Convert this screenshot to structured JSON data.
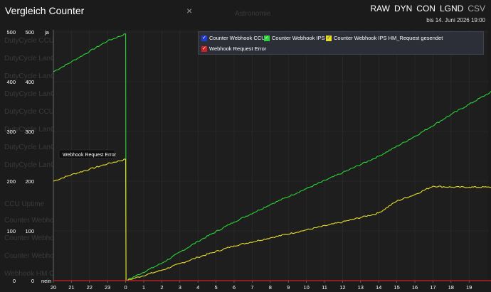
{
  "window": {
    "title": "Vergleich Counter",
    "toolbar": [
      {
        "label": "RAW",
        "active": true
      },
      {
        "label": "DYN",
        "active": true
      },
      {
        "label": "CON",
        "active": true
      },
      {
        "label": "LGND",
        "active": true
      },
      {
        "label": "CSV",
        "active": false
      }
    ],
    "range_label": "bis 14. Juni 2026 19:00"
  },
  "legend": [
    {
      "label": "Counter Webhook CCU",
      "color": "#1f3bd6",
      "checked": true
    },
    {
      "label": "Counter Webhook IPS",
      "color": "#2bd437",
      "checked": true
    },
    {
      "label": "Counter Webhook IPS HM_Request gesendet",
      "color": "#e6df2a",
      "checked": true
    },
    {
      "label": "Webhook Request Error",
      "color": "#d22020",
      "checked": true
    }
  ],
  "tooltip": "Webhook Request Error",
  "chart_data": {
    "type": "line",
    "title": "Vergleich Counter",
    "y_axes": [
      {
        "ticks": [
          "0",
          "100",
          "200",
          "300",
          "400",
          "500"
        ],
        "range": [
          0,
          500
        ]
      },
      {
        "ticks": [
          "0",
          "100",
          "200",
          "300",
          "400",
          "500"
        ],
        "range": [
          0,
          500
        ]
      },
      {
        "ticks": [
          "nein",
          "ja"
        ],
        "range": [
          0,
          1
        ]
      }
    ],
    "x_ticks": [
      "20",
      "21",
      "22",
      "23",
      "0",
      "1",
      "2",
      "3",
      "4",
      "5",
      "6",
      "7",
      "8",
      "9",
      "10",
      "11",
      "12",
      "13",
      "14",
      "15",
      "16",
      "17",
      "18",
      "19"
    ],
    "x_range_hours": [
      20,
      44
    ],
    "series": [
      {
        "name": "Counter Webhook IPS",
        "color": "#2bd437",
        "points": [
          [
            20,
            420
          ],
          [
            21,
            440
          ],
          [
            22,
            461
          ],
          [
            23,
            482
          ],
          [
            24,
            496
          ],
          [
            24.02,
            0
          ],
          [
            26,
            35
          ],
          [
            28,
            79
          ],
          [
            30,
            118
          ],
          [
            32,
            153
          ],
          [
            34,
            185
          ],
          [
            36,
            217
          ],
          [
            38,
            250
          ],
          [
            40,
            290
          ],
          [
            42,
            334
          ],
          [
            44,
            375
          ],
          [
            45.8,
            412
          ]
        ]
      },
      {
        "name": "Counter Webhook IPS HM_Request gesendet",
        "color": "#e6df2a",
        "points": [
          [
            20,
            200
          ],
          [
            21,
            213
          ],
          [
            22,
            224
          ],
          [
            23,
            235
          ],
          [
            24,
            244
          ],
          [
            24.02,
            0
          ],
          [
            26,
            21
          ],
          [
            28,
            47
          ],
          [
            30,
            70
          ],
          [
            32,
            86
          ],
          [
            34,
            102
          ],
          [
            36,
            118
          ],
          [
            38,
            136
          ],
          [
            39,
            160
          ],
          [
            40,
            173
          ],
          [
            41,
            190
          ],
          [
            42,
            188
          ],
          [
            43,
            188
          ],
          [
            44,
            188
          ],
          [
            45.8,
            188
          ]
        ]
      },
      {
        "name": "Webhook Request Error",
        "color": "#d22020",
        "points": [
          [
            20,
            0
          ],
          [
            45.8,
            0
          ]
        ]
      }
    ],
    "grid": true,
    "legend_position": "top"
  }
}
